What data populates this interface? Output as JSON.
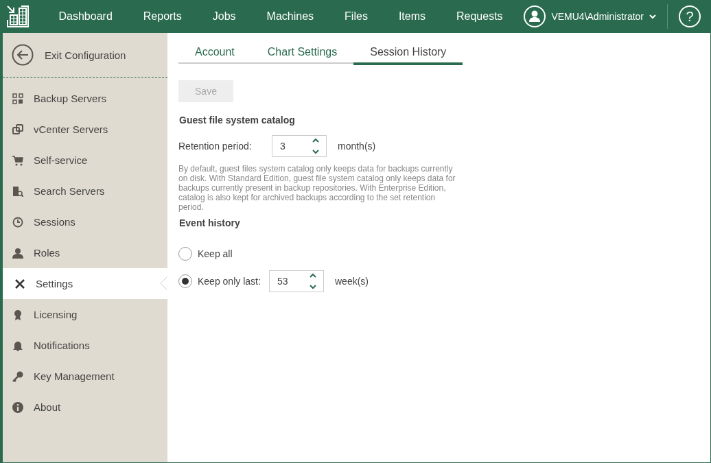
{
  "header": {
    "nav": [
      {
        "label": "Dashboard"
      },
      {
        "label": "Reports"
      },
      {
        "label": "Jobs"
      },
      {
        "label": "Machines"
      },
      {
        "label": "Files"
      },
      {
        "label": "Items"
      },
      {
        "label": "Requests"
      }
    ],
    "user": "VEMU4\\Administrator",
    "help": "?"
  },
  "sidebar": {
    "exit": "Exit Configuration",
    "items": [
      {
        "label": "Backup Servers",
        "selected": false
      },
      {
        "label": "vCenter Servers",
        "selected": false
      },
      {
        "label": "Self-service",
        "selected": false
      },
      {
        "label": "Search Servers",
        "selected": false
      },
      {
        "label": "Sessions",
        "selected": false
      },
      {
        "label": "Roles",
        "selected": false
      },
      {
        "label": "Settings",
        "selected": true
      },
      {
        "label": "Licensing",
        "selected": false
      },
      {
        "label": "Notifications",
        "selected": false
      },
      {
        "label": "Key Management",
        "selected": false
      },
      {
        "label": "About",
        "selected": false
      }
    ]
  },
  "tabs": [
    {
      "label": "Account",
      "selected": false
    },
    {
      "label": "Chart Settings",
      "selected": false
    },
    {
      "label": "Session History",
      "selected": true
    }
  ],
  "save": {
    "label": "Save",
    "disabled": true
  },
  "catalog": {
    "heading": "Guest file system catalog",
    "label": "Retention period:",
    "value": "3",
    "unit": "month(s)",
    "note": "By default, guest files system catalog only keeps data for backups currently on disk. With Standard Edition, guest file system catalog only keeps data for backups currently present in backup repositories. With Enterprise Edition, catalog is also kept for archived backups according to the set retention period."
  },
  "events": {
    "heading": "Event history",
    "options": [
      {
        "kind": "plain",
        "label": "Keep all",
        "selected": false
      },
      {
        "kind": "spinner",
        "label": "Keep only last:",
        "selected": true,
        "value": "53",
        "unit": "week(s)"
      }
    ]
  }
}
